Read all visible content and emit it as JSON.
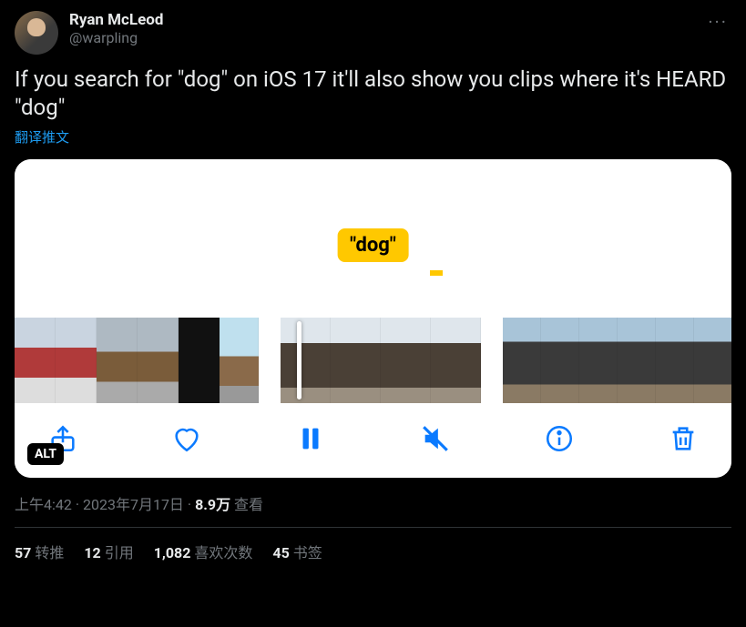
{
  "author": {
    "display_name": "Ryan McLeod",
    "handle": "@warpling"
  },
  "more_label": "···",
  "tweet_text": "If you search for \"dog\" on iOS 17 it'll also show you clips where it's HEARD \"dog\"",
  "translate_label": "翻译推文",
  "media": {
    "caption_bubble": "\"dog\"",
    "alt_badge": "ALT"
  },
  "meta": {
    "time": "上午4:42",
    "date": "2023年7月17日",
    "views_count": "8.9万",
    "views_label": "查看",
    "separator": " · "
  },
  "stats": {
    "retweets": {
      "count": "57",
      "label": "转推"
    },
    "quotes": {
      "count": "12",
      "label": "引用"
    },
    "likes": {
      "count": "1,082",
      "label": "喜欢次数"
    },
    "bookmarks": {
      "count": "45",
      "label": "书签"
    }
  }
}
